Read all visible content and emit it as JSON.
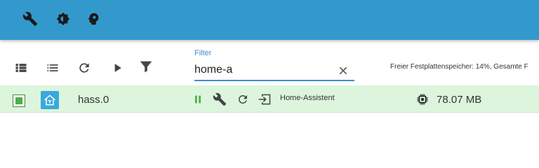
{
  "topbar": {
    "icons": [
      "wrench-icon",
      "settings-chip-icon",
      "brain-head-icon"
    ],
    "color": "#3399cc"
  },
  "toolbar": {
    "icons": [
      "list-view-icon",
      "compact-list-icon",
      "refresh-icon",
      "play-icon",
      "filter-icon"
    ]
  },
  "filter": {
    "label": "Filter",
    "value": "home-a"
  },
  "disk_info": "Freier Festplattenspeicher: 14%, Gesamte F",
  "instance": {
    "name": "hass.0",
    "title": "Home-Assistent",
    "memory": "78.07 MB",
    "status_color": "#4cae4c",
    "row_color": "#dcf5dc"
  }
}
